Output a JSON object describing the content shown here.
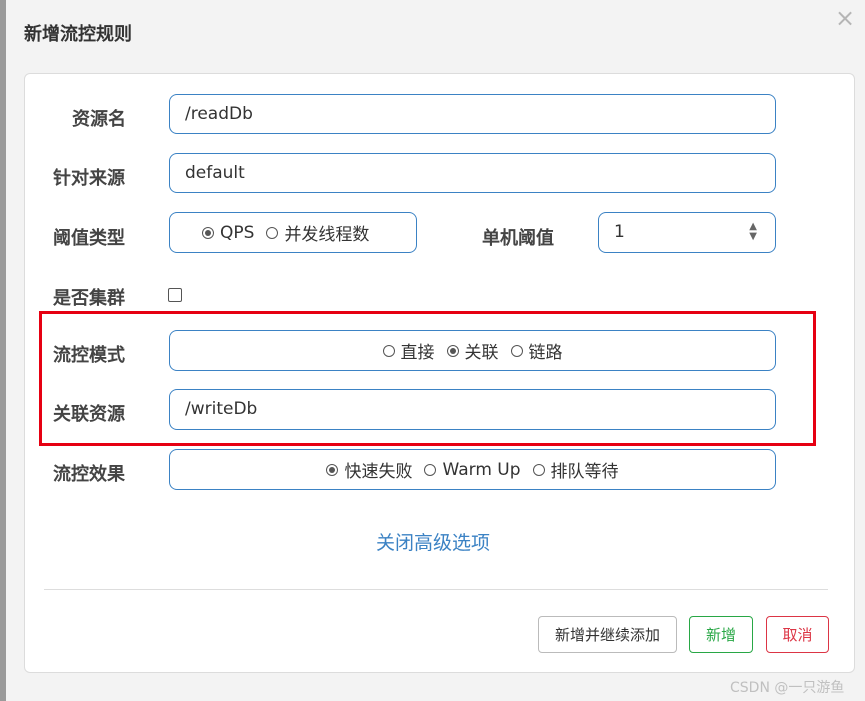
{
  "dialog": {
    "title": "新增流控规则",
    "close_icon": "close-icon"
  },
  "form": {
    "resource_name": {
      "label": "资源名",
      "value": "/readDb"
    },
    "limit_app": {
      "label": "针对来源",
      "value": "default"
    },
    "threshold_type": {
      "label": "阈值类型",
      "options": [
        {
          "label": "QPS",
          "selected": true
        },
        {
          "label": "并发线程数",
          "selected": false
        }
      ]
    },
    "single_threshold": {
      "label": "单机阈值",
      "value": "1"
    },
    "cluster_mode": {
      "label": "是否集群",
      "checked": false
    },
    "strategy": {
      "label": "流控模式",
      "options": [
        {
          "label": "直接",
          "selected": false
        },
        {
          "label": "关联",
          "selected": true
        },
        {
          "label": "链路",
          "selected": false
        }
      ]
    },
    "ref_resource": {
      "label": "关联资源",
      "value": "/writeDb"
    },
    "control_behavior": {
      "label": "流控效果",
      "options": [
        {
          "label": "快速失败",
          "selected": true
        },
        {
          "label": "Warm Up",
          "selected": false
        },
        {
          "label": "排队等待",
          "selected": false
        }
      ]
    },
    "advanced_link": "关闭高级选项"
  },
  "footer": {
    "continue_label": "新增并继续添加",
    "add_label": "新增",
    "cancel_label": "取消"
  },
  "watermark": "CSDN @一只游鱼",
  "colors": {
    "input_border": "#3b82c4",
    "highlight_box": "#e60012",
    "add_button": "#28a745",
    "cancel_button": "#dc3545",
    "link": "#3b82c4"
  }
}
